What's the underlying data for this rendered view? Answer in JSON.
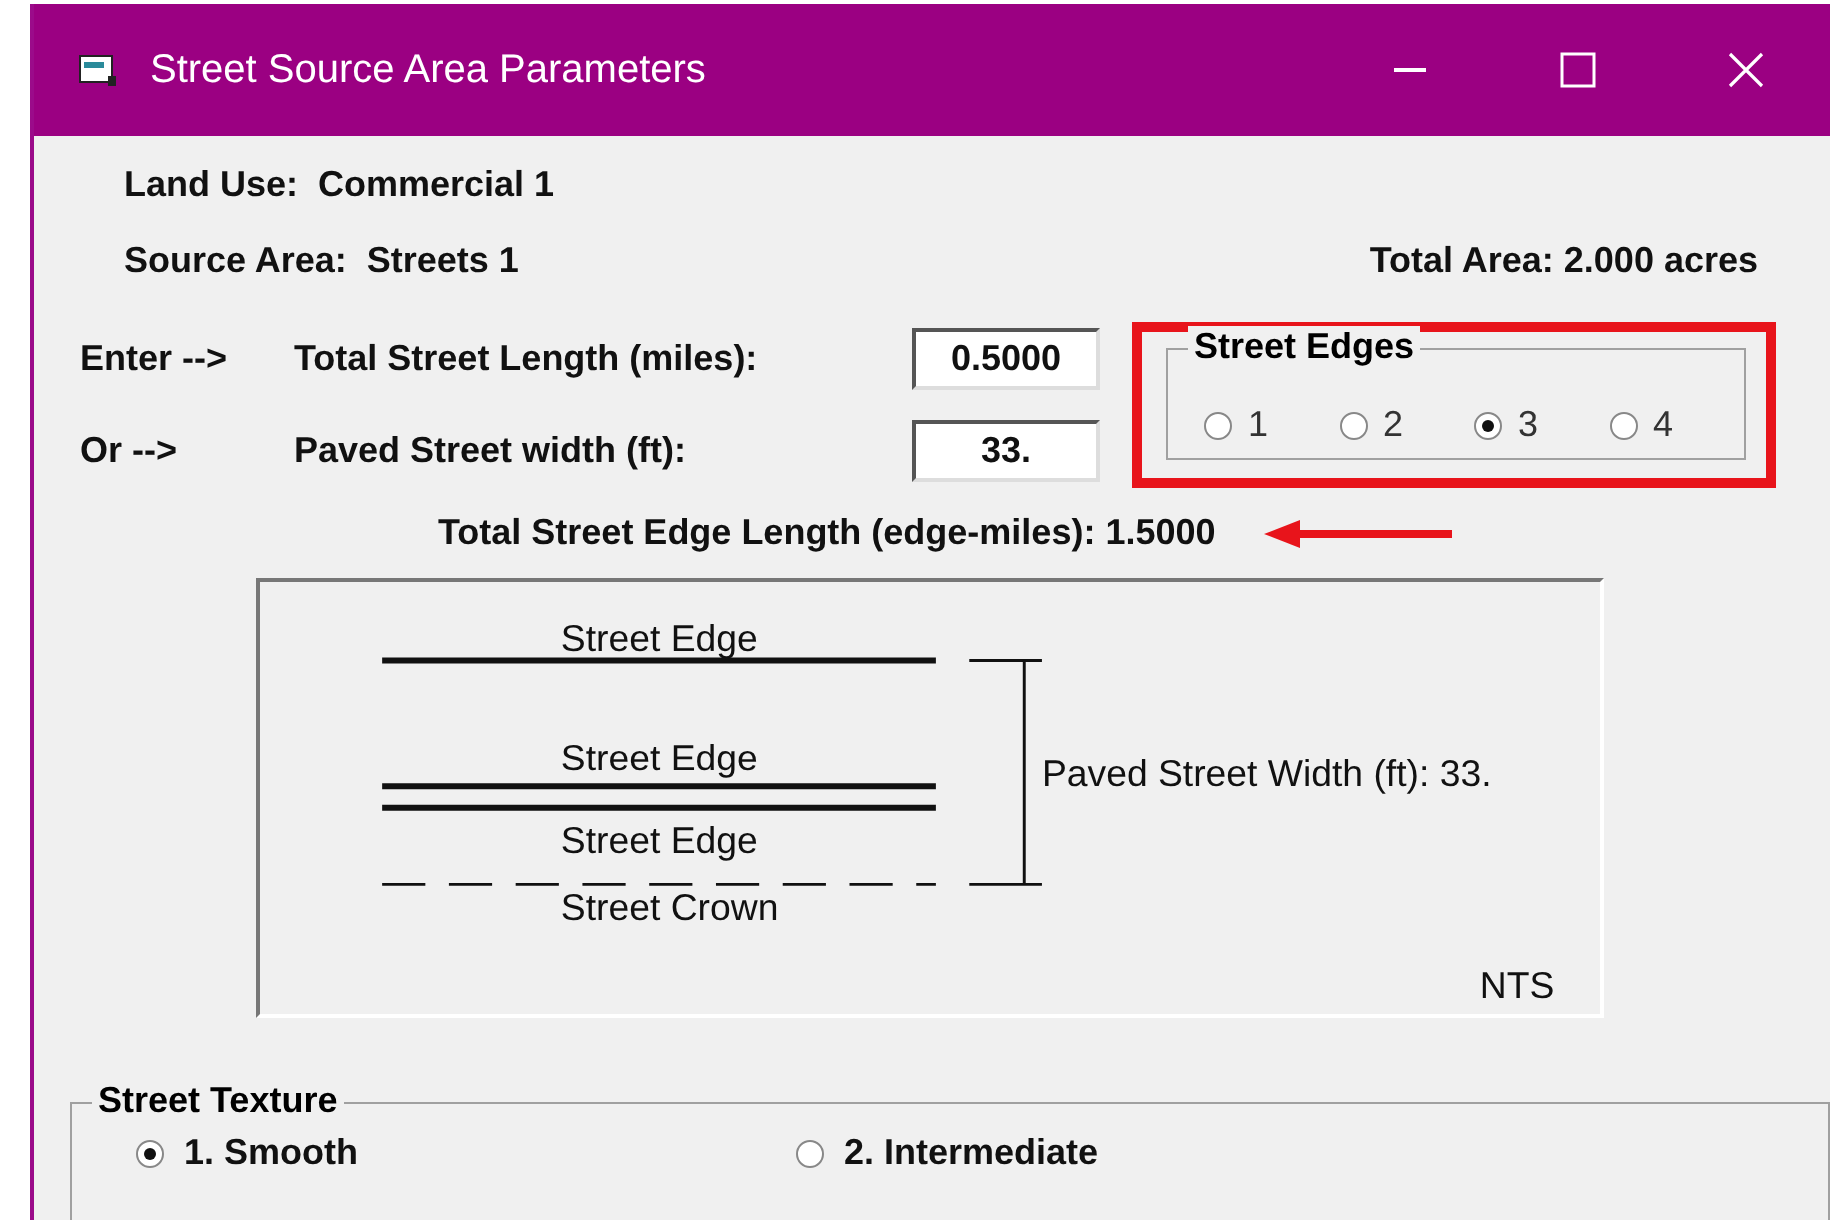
{
  "window": {
    "title": "Street Source Area Parameters"
  },
  "land_use": "Land Use:  Commercial 1",
  "source_area": "Source Area:  Streets 1",
  "total_area": "Total Area: 2.000 acres",
  "inputs": [
    {
      "prefix": "Enter -->",
      "label": "Total Street Length (miles):",
      "value": "0.5000"
    },
    {
      "prefix": "Or -->",
      "label": "Paved Street width (ft):",
      "value": "33."
    }
  ],
  "street_edges": {
    "title": "Street Edges",
    "options": [
      {
        "label": "1",
        "selected": false
      },
      {
        "label": "2",
        "selected": false
      },
      {
        "label": "3",
        "selected": true
      },
      {
        "label": "4",
        "selected": false
      }
    ]
  },
  "edge_length": "Total Street Edge Length (edge-miles): 1.5000",
  "diagram": {
    "edge_labels": [
      "Street Edge",
      "Street Edge",
      "Street Edge"
    ],
    "crown_label": "Street Crown",
    "width_label": "Paved Street Width (ft): 33.",
    "scale_note": "NTS"
  },
  "street_texture": {
    "title": "Street Texture",
    "options": [
      {
        "label": "1. Smooth",
        "selected": true
      },
      {
        "label": "2. Intermediate",
        "selected": false
      }
    ]
  }
}
